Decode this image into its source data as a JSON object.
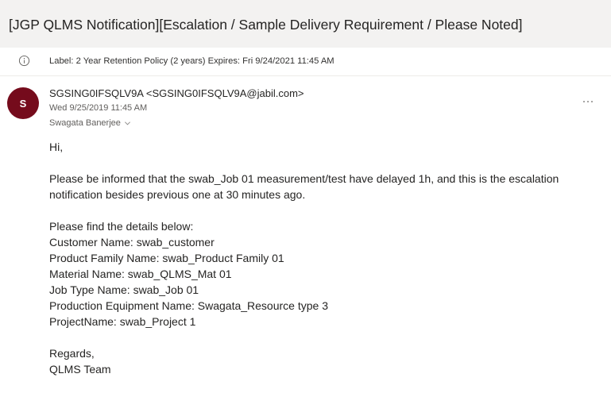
{
  "message": {
    "subject": "[JGP QLMS Notification][Escalation / Sample Delivery Requirement / Please Noted]",
    "retention_label": "Label: 2 Year Retention Policy (2 years) Expires: Fri 9/24/2021 11:45 AM",
    "avatar_initial": "S",
    "avatar_color": "#750b1c",
    "sender": "SGSING0IFSQLV9A <SGSING0IFSQLV9A@jabil.com>",
    "date": "Wed 9/25/2019 11:45 AM",
    "recipient": "Swagata Banerjee",
    "icons": [
      "info-icon",
      "chevron-down-icon",
      "more-options-icon"
    ]
  },
  "body": {
    "greeting": "Hi,",
    "intro_line1": "Please be informed that the swab_Job 01 measurement/test have delayed 1h, and this is the escalation",
    "intro_line2": "notification besides previous one at 30 minutes ago.",
    "details_heading": "Please find the details below:",
    "customer": "Customer Name: swab_customer",
    "product_family": "Product Family Name: swab_Product Family 01",
    "material": "Material Name: swab_QLMS_Mat 01",
    "job_type": "Job Type Name: swab_Job 01",
    "equipment": "Production Equipment Name: Swagata_Resource type 3",
    "project": "ProjectName: swab_Project 1",
    "closing": "Regards,",
    "signature": "QLMS Team"
  }
}
